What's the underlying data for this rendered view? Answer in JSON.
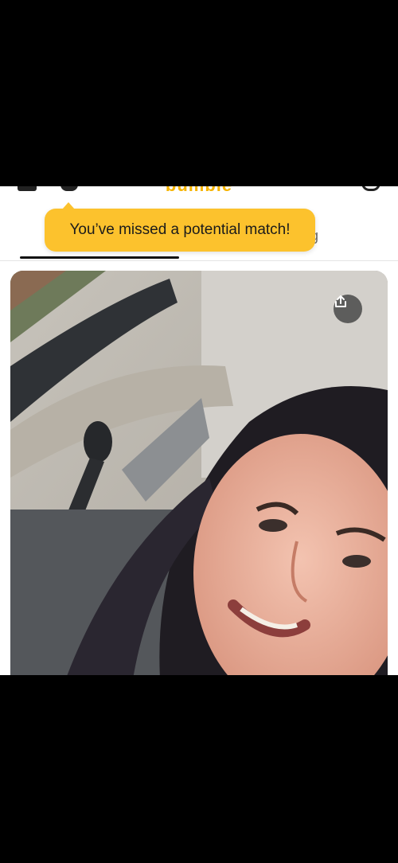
{
  "header": {
    "logo_text": "bumble",
    "left_icons": [
      "menu-icon",
      "profile-icon"
    ],
    "right_icon": "filter-icon"
  },
  "tabs": {
    "right_label_fragment": "ng"
  },
  "tooltip": {
    "text": "You’ve missed a potential match!",
    "color": "#fcc22d"
  },
  "photo": {
    "action_icon": "share-icon",
    "subject": "selfie-photo"
  }
}
